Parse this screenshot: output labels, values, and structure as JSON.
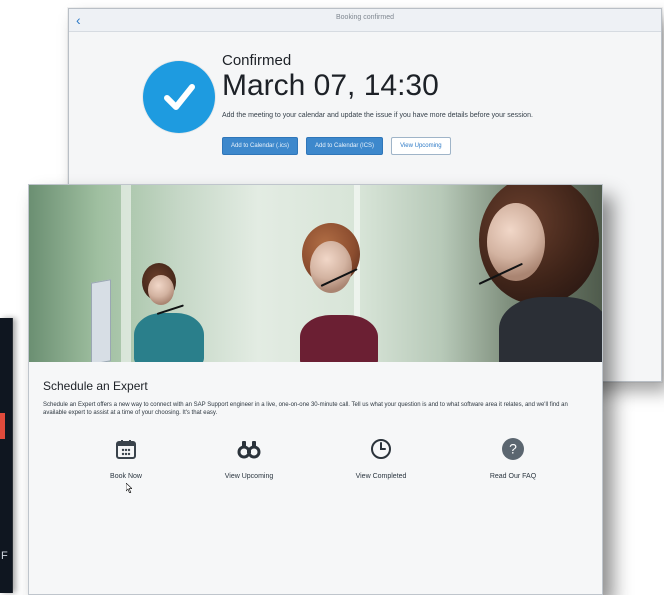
{
  "left_window": {
    "partial_text": "F"
  },
  "booking": {
    "title": "Booking confirmed",
    "status": "Confirmed",
    "datetime": "March 07, 14:30",
    "description": "Add the meeting to your calendar and update the issue if you have more details before your session.",
    "buttons": {
      "add_ics_1": "Add to Calendar (.ics)",
      "add_ics_2": "Add to Calendar (ICS)",
      "view_upcoming": "View Upcoming"
    }
  },
  "schedule": {
    "title": "Schedule an Expert",
    "description": "Schedule an Expert offers a new way to connect with an SAP Support engineer in a live, one-on-one 30-minute call. Tell us what your question is and to what software area it relates, and we'll find an available expert to assist at a time of your choosing. It's that easy.",
    "actions": [
      {
        "label": "Book Now",
        "icon": "calendar-icon"
      },
      {
        "label": "View Upcoming",
        "icon": "binoculars-icon"
      },
      {
        "label": "View Completed",
        "icon": "clock-icon"
      },
      {
        "label": "Read Our FAQ",
        "icon": "question-icon"
      }
    ]
  },
  "colors": {
    "accent_blue": "#1e9be0",
    "button_blue": "#3d88cc",
    "text_dark": "#1d2127",
    "faq_gray": "#5b6670"
  }
}
